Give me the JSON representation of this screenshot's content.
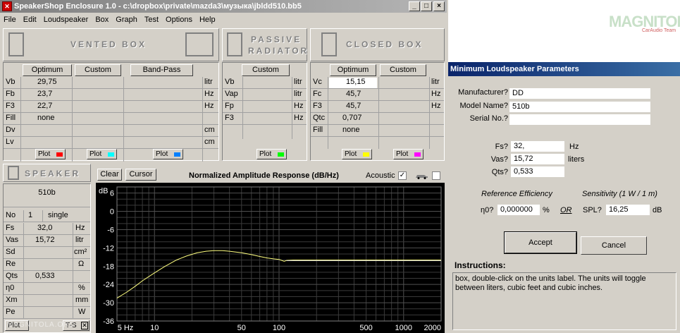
{
  "window": {
    "title": "SpeakerShop Enclosure 1.0 - c:\\dropbox\\private\\mazda3\\музыка\\jbldd510.bb5",
    "app_icon": "speaker-app-icon"
  },
  "menu": [
    "File",
    "Edit",
    "Loudspeaker",
    "Box",
    "Graph",
    "Test",
    "Options",
    "Help"
  ],
  "vented": {
    "title": "VENTED BOX",
    "buttons": [
      "Optimum",
      "Custom",
      "Band-Pass"
    ],
    "rows": [
      {
        "label": "Vb",
        "v1": "29,75",
        "unit": "litr"
      },
      {
        "label": "Fb",
        "v1": "23,7",
        "unit": "Hz"
      },
      {
        "label": "F3",
        "v1": "22,7",
        "unit": "Hz"
      },
      {
        "label": "Fill",
        "v1": "none",
        "unit": ""
      },
      {
        "label": "Dv",
        "v1": "",
        "unit": "cm"
      },
      {
        "label": "Lv",
        "v1": "",
        "unit": "cm"
      }
    ],
    "plot_label": "Plot",
    "plot_colors": [
      "#ff0000",
      "#00ffff",
      "#0080ff"
    ]
  },
  "passive": {
    "title1": "PASSIVE",
    "title2": "RADIATOR",
    "button": "Custom",
    "rows": [
      {
        "label": "Vb",
        "unit": "litr"
      },
      {
        "label": "Vap",
        "unit": "litr"
      },
      {
        "label": "Fp",
        "unit": "Hz"
      },
      {
        "label": "F3",
        "unit": "Hz"
      }
    ],
    "plot_label": "Plot",
    "plot_color": "#00ff00"
  },
  "closed": {
    "title": "CLOSED BOX",
    "buttons": [
      "Optimum",
      "Custom"
    ],
    "rows": [
      {
        "label": "Vc",
        "v1": "15,15",
        "unit": "litr"
      },
      {
        "label": "Fc",
        "v1": "45,7",
        "unit": "Hz"
      },
      {
        "label": "F3",
        "v1": "45,7",
        "unit": "Hz"
      },
      {
        "label": "Qtc",
        "v1": "0,707",
        "unit": ""
      },
      {
        "label": "Fill",
        "v1": "none",
        "unit": ""
      }
    ],
    "plot_label": "Plot",
    "plot_colors": [
      "#ffff00",
      "#ff00ff"
    ]
  },
  "speaker": {
    "title": "SPEAKER",
    "model": "510b",
    "no_label": "No",
    "no_value": "1",
    "mode": "single",
    "rows": [
      {
        "label": "Fs",
        "value": "32,0",
        "unit": "Hz"
      },
      {
        "label": "Vas",
        "value": "15,72",
        "unit": "litr"
      },
      {
        "label": "Sd",
        "value": "",
        "unit": "cm²"
      },
      {
        "label": "Re",
        "value": "",
        "unit": "Ω"
      },
      {
        "label": "Qts",
        "value": "0,533",
        "unit": ""
      },
      {
        "label": "η0",
        "value": "",
        "unit": "%"
      },
      {
        "label": "Xm",
        "value": "",
        "unit": "mm"
      },
      {
        "label": "Pe",
        "value": "",
        "unit": "W"
      }
    ],
    "plot_label": "Plot",
    "ts_label": "T-S"
  },
  "graph": {
    "clear": "Clear",
    "cursor": "Cursor",
    "title": "Normalized Amplitude Response (dB/Hz)",
    "acoustic": "Acoustic"
  },
  "chart_data": {
    "type": "line",
    "title": "Normalized Amplitude Response (dB/Hz)",
    "xscale": "log",
    "xlim": [
      5,
      2000
    ],
    "ylim": [
      -36,
      8
    ],
    "ylabel": "dB",
    "yticks": [
      6,
      0,
      -6,
      -12,
      -18,
      -24,
      -30,
      -36
    ],
    "xticks": [
      {
        "v": 5,
        "t": "5 Hz"
      },
      {
        "v": 10,
        "t": "10"
      },
      {
        "v": 50,
        "t": "50"
      },
      {
        "v": 100,
        "t": "100"
      },
      {
        "v": 500,
        "t": "500"
      },
      {
        "v": 1000,
        "t": "1000"
      },
      {
        "v": 2000,
        "t": "2000"
      }
    ],
    "grid": true,
    "series": [
      {
        "color": "#ffff80",
        "x": [
          5,
          6,
          7,
          8,
          10,
          12,
          15,
          18,
          22,
          26,
          30,
          35,
          40,
          50,
          60,
          70,
          80,
          90,
          100,
          110,
          115,
          130,
          200,
          500,
          1000,
          2000
        ],
        "y": [
          -28.5,
          -26.5,
          -24.6,
          -22.8,
          -20.2,
          -18.2,
          -16.0,
          -14.7,
          -13.6,
          -13.1,
          -12.9,
          -12.9,
          -13.1,
          -13.6,
          -14.2,
          -14.8,
          -15.3,
          -15.6,
          -15.8,
          -16.4,
          -16.1,
          -16.0,
          -16.0,
          -16.0,
          -16.0,
          -16.0
        ]
      },
      {
        "color": "#d0d0d0",
        "x": [
          115,
          2000
        ],
        "y": [
          -16.2,
          -16.2
        ]
      }
    ]
  },
  "brand": {
    "logo_text": "MAGNITOLA",
    "logo_sub": "CarAudio Team"
  },
  "dialog": {
    "title": "Minimum Loudspeaker Parameters",
    "manufacturer_label": "Manufacturer?",
    "manufacturer": "DD",
    "model_label": "Model Name?",
    "model": "510b",
    "serial_label": "Serial No.?",
    "serial": "",
    "fs_label": "Fs?",
    "fs": "32,",
    "fs_unit": "Hz",
    "vas_label": "Vas?",
    "vas": "15,72",
    "vas_unit": "liters",
    "qts_label": "Qts?",
    "qts": "0,533",
    "ref_eff": "Reference Efficiency",
    "sensitivity": "Sensitivity (1 W / 1 m)",
    "eta_label": "η0?",
    "eta": "0,000000",
    "eta_unit": "%",
    "or": "OR",
    "spl_label": "SPL?",
    "spl": "16,25",
    "spl_unit": "dB",
    "accept": "Accept",
    "cancel": "Cancel",
    "instructions_label": "Instructions:",
    "instructions": "box, double-click on the units label. The units will toggle between liters, cubic feet and cubic inches."
  },
  "watermark": "MAGNITOLA.ORG"
}
